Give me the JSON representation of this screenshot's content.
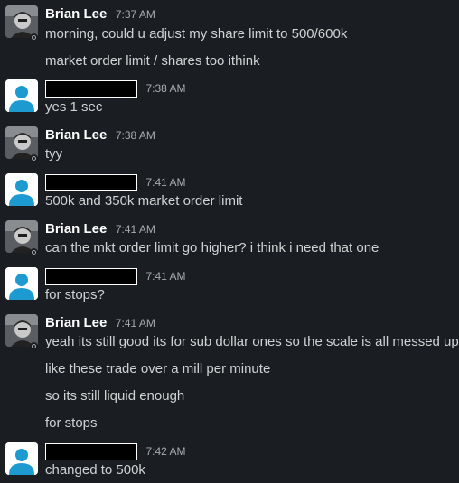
{
  "messages": [
    {
      "author": "Brian Lee",
      "time": "7:37 AM",
      "avatar": "user-photo",
      "lines": [
        "morning, could u adjust my share limit to 500/600k",
        "market order limit / shares too  ithink"
      ]
    },
    {
      "author": "",
      "author_redacted": true,
      "time": "7:38 AM",
      "avatar": "default-person-avatar",
      "lines": [
        "yes 1 sec"
      ]
    },
    {
      "author": "Brian Lee",
      "time": "7:38 AM",
      "avatar": "user-photo",
      "lines": [
        "tyy"
      ]
    },
    {
      "author": "",
      "author_redacted": true,
      "time": "7:41 AM",
      "avatar": "default-person-avatar",
      "lines": [
        "500k and 350k market order limit"
      ]
    },
    {
      "author": "Brian Lee",
      "time": "7:41 AM",
      "avatar": "user-photo",
      "lines": [
        "can the mkt order limit go higher? i think i need that one"
      ]
    },
    {
      "author": "",
      "author_redacted": true,
      "time": "7:41 AM",
      "avatar": "default-person-avatar",
      "lines": [
        "for stops?"
      ]
    },
    {
      "author": "Brian Lee",
      "time": "7:41 AM",
      "avatar": "user-photo",
      "lines": [
        "yeah its still good its for sub dollar ones so the scale is all messed up",
        "like these trade over a mill per minute",
        "so its still liquid enough",
        "for stops"
      ]
    },
    {
      "author": "",
      "author_redacted": true,
      "time": "7:42 AM",
      "avatar": "default-person-avatar",
      "lines": [
        "changed to 500k"
      ]
    }
  ],
  "colors": {
    "background": "#1a1d21",
    "name": "#ffffff",
    "text": "#d1d2d3",
    "timestamp": "#ababad",
    "default_avatar": "#1d9bd1"
  }
}
